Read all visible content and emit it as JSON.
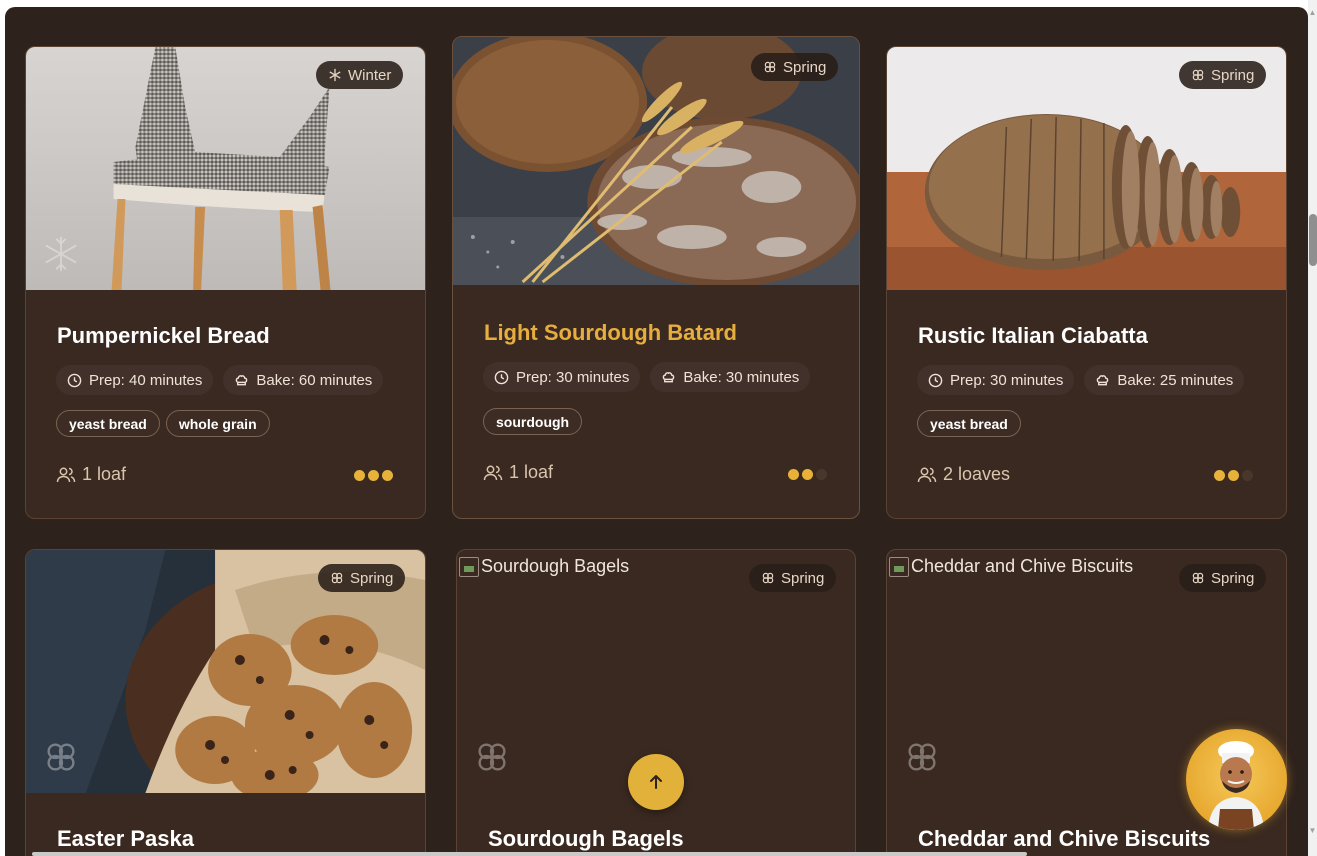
{
  "colors": {
    "background": "#2e221d",
    "card": "#3a2920",
    "accent": "#e6ad3f",
    "difficulty_on": "#e8b23a",
    "difficulty_off": "#4a372c"
  },
  "cards": [
    {
      "title": "Pumpernickel Bread",
      "season": "Winter",
      "season_icon": "snowflake-icon",
      "image": "upholstered-chair-photo",
      "prep": "Prep: 40 minutes",
      "bake": "Bake: 60 minutes",
      "tags": [
        "yeast bread",
        "whole grain"
      ],
      "yield": "1 loaf",
      "difficulty": 3
    },
    {
      "title": "Light Sourdough Batard",
      "season": "Spring",
      "season_icon": "flower-icon",
      "image": "rustic-bread-loaves-with-wheat-photo",
      "prep": "Prep: 30 minutes",
      "bake": "Bake: 30 minutes",
      "tags": [
        "sourdough"
      ],
      "yield": "1 loaf",
      "difficulty": 2
    },
    {
      "title": "Rustic Italian Ciabatta",
      "season": "Spring",
      "season_icon": "flower-icon",
      "image": "sliced-bread-loaf-photo",
      "prep": "Prep: 30 minutes",
      "bake": "Bake: 25 minutes",
      "tags": [
        "yeast bread"
      ],
      "yield": "2 loaves",
      "difficulty": 2
    },
    {
      "title": "Easter Paska",
      "season": "Spring",
      "season_icon": "flower-icon",
      "image": "chocolate-chip-cookies-photo"
    },
    {
      "title": "Sourdough Bagels",
      "season": "Spring",
      "season_icon": "flower-icon",
      "image_alt": "Sourdough Bagels"
    },
    {
      "title": "Cheddar and Chive Biscuits",
      "season": "Spring",
      "season_icon": "flower-icon",
      "image_alt": "Cheddar and Chive Biscuits"
    }
  ],
  "controls": {
    "back_to_top_icon": "arrow-up-icon",
    "assistant_avatar": "chef-avatar"
  }
}
